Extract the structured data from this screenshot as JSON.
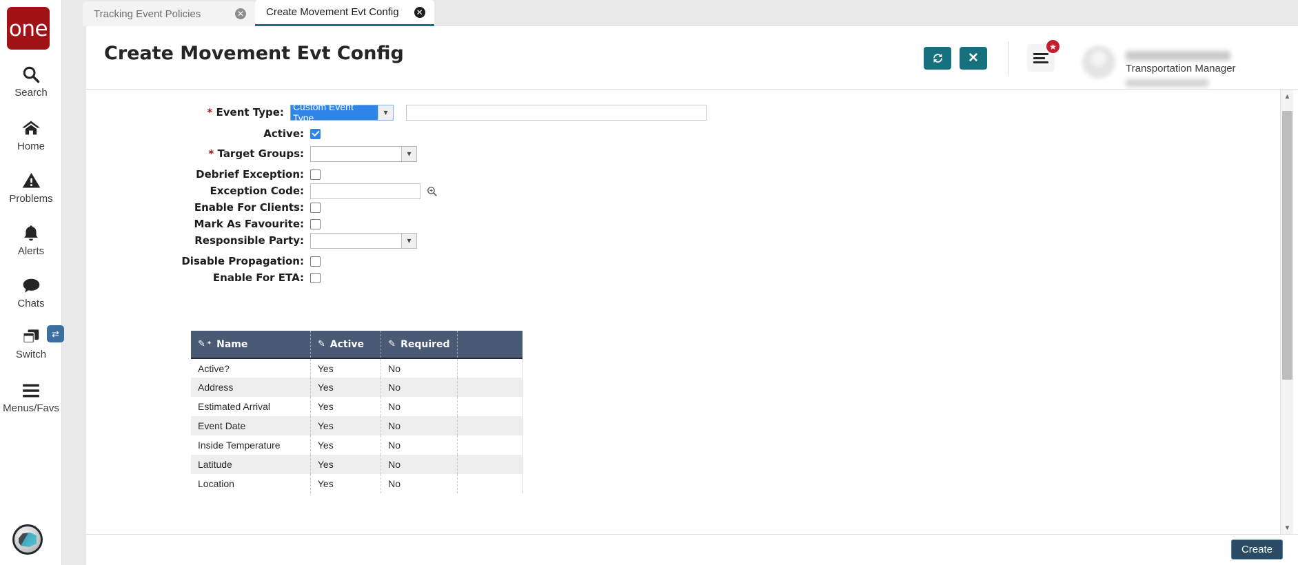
{
  "brand": {
    "logo_text": "one",
    "logo_color": "#a01317"
  },
  "rail": {
    "items": [
      {
        "label": "Search",
        "icon": "search-icon"
      },
      {
        "label": "Home",
        "icon": "home-icon"
      },
      {
        "label": "Problems",
        "icon": "warning-triangle-icon"
      },
      {
        "label": "Alerts",
        "icon": "bell-icon"
      },
      {
        "label": "Chats",
        "icon": "chat-bubble-icon"
      },
      {
        "label": "Switch",
        "icon": "windows-stack-icon"
      },
      {
        "label": "Menus/Favs",
        "icon": "hamburger-icon"
      }
    ],
    "assistant_icon": "assistant-avatar-icon"
  },
  "tabs": [
    {
      "label": "Tracking Event Policies",
      "active": false,
      "close_icon": "close-circle-icon"
    },
    {
      "label": "Create Movement Evt Config",
      "active": true,
      "close_icon": "close-circle-icon"
    }
  ],
  "header": {
    "title": "Create Movement Evt Config",
    "refresh_icon": "refresh-icon",
    "close_icon": "x-icon",
    "menu_icon": "hamburger-icon",
    "badge_icon": "star-icon",
    "avatar_icon": "user-avatar-icon",
    "user_role": "Transportation Manager",
    "caret_icon": "chevron-down-icon",
    "accent_color": "#17707e"
  },
  "form": {
    "event_type": {
      "label": "Event Type:",
      "required": true,
      "value": "Custom Event Type",
      "selected": true,
      "extra_value": "",
      "extra_placeholder": ""
    },
    "active": {
      "label": "Active:",
      "checked": true
    },
    "target_groups": {
      "label": "Target Groups:",
      "required": true,
      "value": ""
    },
    "debrief_exception": {
      "label": "Debrief Exception:",
      "checked": false
    },
    "exception_code": {
      "label": "Exception Code:",
      "value": "",
      "search_icon": "magnifier-icon"
    },
    "enable_for_clients": {
      "label": "Enable For Clients:",
      "checked": false
    },
    "mark_as_favourite": {
      "label": "Mark As Favourite:",
      "checked": false
    },
    "responsible_party": {
      "label": "Responsible Party:",
      "value": ""
    },
    "disable_propagation": {
      "label": "Disable Propagation:",
      "checked": false
    },
    "enable_for_eta": {
      "label": "Enable For ETA:",
      "checked": false
    }
  },
  "grid": {
    "columns": [
      {
        "label": "Name",
        "edit_icon": "pencil-icon",
        "required_marker": "*"
      },
      {
        "label": "Active",
        "edit_icon": "pencil-icon",
        "required_marker": ""
      },
      {
        "label": "Required",
        "edit_icon": "pencil-icon",
        "required_marker": ""
      },
      {
        "label": "",
        "edit_icon": "",
        "required_marker": ""
      }
    ],
    "rows": [
      {
        "name": "Active?",
        "active": "Yes",
        "required": "No"
      },
      {
        "name": "Address",
        "active": "Yes",
        "required": "No"
      },
      {
        "name": "Estimated Arrival",
        "active": "Yes",
        "required": "No"
      },
      {
        "name": "Event Date",
        "active": "Yes",
        "required": "No"
      },
      {
        "name": "Inside Temperature",
        "active": "Yes",
        "required": "No"
      },
      {
        "name": "Latitude",
        "active": "Yes",
        "required": "No"
      },
      {
        "name": "Location",
        "active": "Yes",
        "required": "No"
      }
    ]
  },
  "scrollbar": {
    "up_icon": "caret-up-icon",
    "down_icon": "caret-down-icon"
  },
  "footer": {
    "create_label": "Create"
  }
}
